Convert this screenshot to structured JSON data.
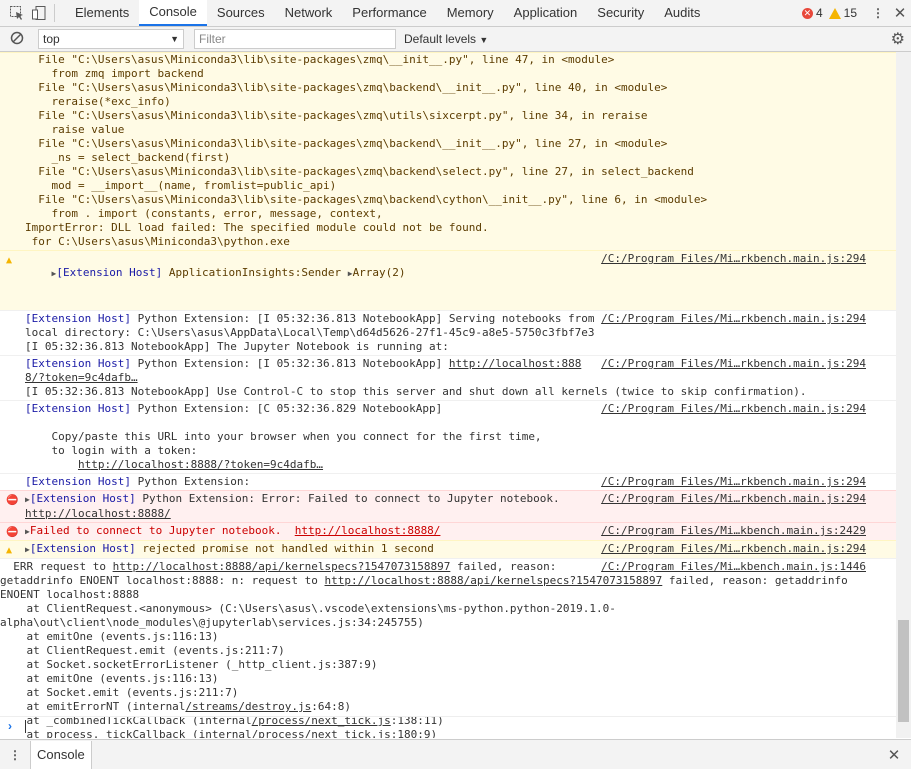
{
  "tabs": [
    "Elements",
    "Console",
    "Sources",
    "Network",
    "Performance",
    "Memory",
    "Application",
    "Security",
    "Audits"
  ],
  "counts": {
    "errors": "4",
    "warnings": "15"
  },
  "filterbar": {
    "context": "top",
    "filter_placeholder": "Filter",
    "levels": "Default levels"
  },
  "trace_lines": [
    "  File \"C:\\Users\\asus\\Miniconda3\\lib\\site-packages\\zmq\\__init__.py\", line 47, in <module>",
    "    from zmq import backend",
    "  File \"C:\\Users\\asus\\Miniconda3\\lib\\site-packages\\zmq\\backend\\__init__.py\", line 40, in <module>",
    "    reraise(*exc_info)",
    "  File \"C:\\Users\\asus\\Miniconda3\\lib\\site-packages\\zmq\\utils\\sixcerpt.py\", line 34, in reraise",
    "    raise value",
    "  File \"C:\\Users\\asus\\Miniconda3\\lib\\site-packages\\zmq\\backend\\__init__.py\", line 27, in <module>",
    "    _ns = select_backend(first)",
    "  File \"C:\\Users\\asus\\Miniconda3\\lib\\site-packages\\zmq\\backend\\select.py\", line 27, in select_backend",
    "    mod = __import__(name, fromlist=public_api)",
    "  File \"C:\\Users\\asus\\Miniconda3\\lib\\site-packages\\zmq\\backend\\cython\\__init__.py\", line 6, in <module>",
    "    from . import (constants, error, message, context,",
    "ImportError: DLL load failed: The specified module could not be found.",
    " for C:\\Users\\asus\\Miniconda3\\python.exe"
  ],
  "messages": {
    "m1": {
      "prefix": "[Extension Host]",
      "text": " ApplicationInsights:Sender ",
      "extra": "Array(2)",
      "src": "/C:/Program Files/Mi…rkbench.main.js:294"
    },
    "m2": {
      "prefix": "[Extension Host]",
      "line1": " Python Extension: [I 05:32:36.813 NotebookApp] Serving notebooks from",
      "line2": "local directory: C:\\Users\\asus\\AppData\\Local\\Temp\\d64d5626-27f1-45c9-a8e5-5750c3fbf7e3",
      "line3": "[I 05:32:36.813 NotebookApp] The Jupyter Notebook is running at:",
      "src": "/C:/Program Files/Mi…rkbench.main.js:294"
    },
    "m3": {
      "prefix": "[Extension Host]",
      "line1": " Python Extension: [I 05:32:36.813 NotebookApp] ",
      "url": "http://localhost:888",
      "line2": "8/?token=9c4dafb…",
      "line3": "[I 05:32:36.813 NotebookApp] Use Control-C to stop this server and shut down all kernels (twice to skip confirmation).",
      "src": "/C:/Program Files/Mi…rkbench.main.js:294"
    },
    "m4": {
      "prefix": "[Extension Host]",
      "line1": " Python Extension: [C 05:32:36.829 NotebookApp]",
      "line2": "    Copy/paste this URL into your browser when you connect for the first time,",
      "line3": "    to login with a token:",
      "line4": "http://localhost:8888/?token=9c4dafb…",
      "src": "/C:/Program Files/Mi…rkbench.main.js:294"
    },
    "m5": {
      "prefix": "[Extension Host]",
      "text": " Python Extension:",
      "src": "/C:/Program Files/Mi…rkbench.main.js:294"
    },
    "m6": {
      "prefix": "[Extension Host]",
      "text": " Python Extension: Error: Failed to connect to Jupyter notebook.",
      "url": "http://localhost:8888/",
      "src": "/C:/Program Files/Mi…rkbench.main.js:294"
    },
    "m7": {
      "text": "Failed to connect to Jupyter notebook.  ",
      "url": "http://localhost:8888/",
      "src": "/C:/Program Files/Mi…kbench.main.js:2429"
    },
    "m8": {
      "prefix": "[Extension Host]",
      "text": " rejected promise not handled within 1 second",
      "src": "/C:/Program Files/Mi…rkbench.main.js:294"
    },
    "m9": {
      "err": "ERR request to ",
      "url1": "http://localhost:8888/api/kernelspecs?1547073158897",
      "mid": " failed, reason: ",
      "line2a": "getaddrinfo ENOENT localhost:8888: n: request to ",
      "url2": "http://localhost:8888/api/kernelspecs?1547073158897",
      "line2b": " failed, reason: getaddrinfo",
      "line3": "ENOENT localhost:8888",
      "line4": "    at ClientRequest.<anonymous> (C:\\Users\\asus\\.vscode\\extensions\\ms-python.python-2019.1.0-",
      "line5": "alpha\\out\\client\\node_modules\\@jupyterlab\\services.js:34:245755)",
      "line6": "    at emitOne (events.js:116:13)",
      "line7": "    at ClientRequest.emit (events.js:211:7)",
      "line8": "    at Socket.socketErrorListener (_http_client.js:387:9)",
      "line9": "    at emitOne (events.js:116:13)",
      "line10": "    at Socket.emit (events.js:211:7)",
      "line11a": "    at emitErrorNT (internal",
      "line11l": "/streams/destroy.js",
      "line11b": ":64:8)",
      "line12a": "    at _combinedTickCallback (internal",
      "line12l": "/process/next_tick.js",
      "line12b": ":138:11)",
      "line13a": "    at process._tickCallback (internal",
      "line13l": "/process/next_tick.js",
      "line13b": ":180:9)",
      "src": "/C:/Program Files/Mi…kbench.main.js:1446"
    }
  },
  "drawer": {
    "tab": "Console"
  }
}
